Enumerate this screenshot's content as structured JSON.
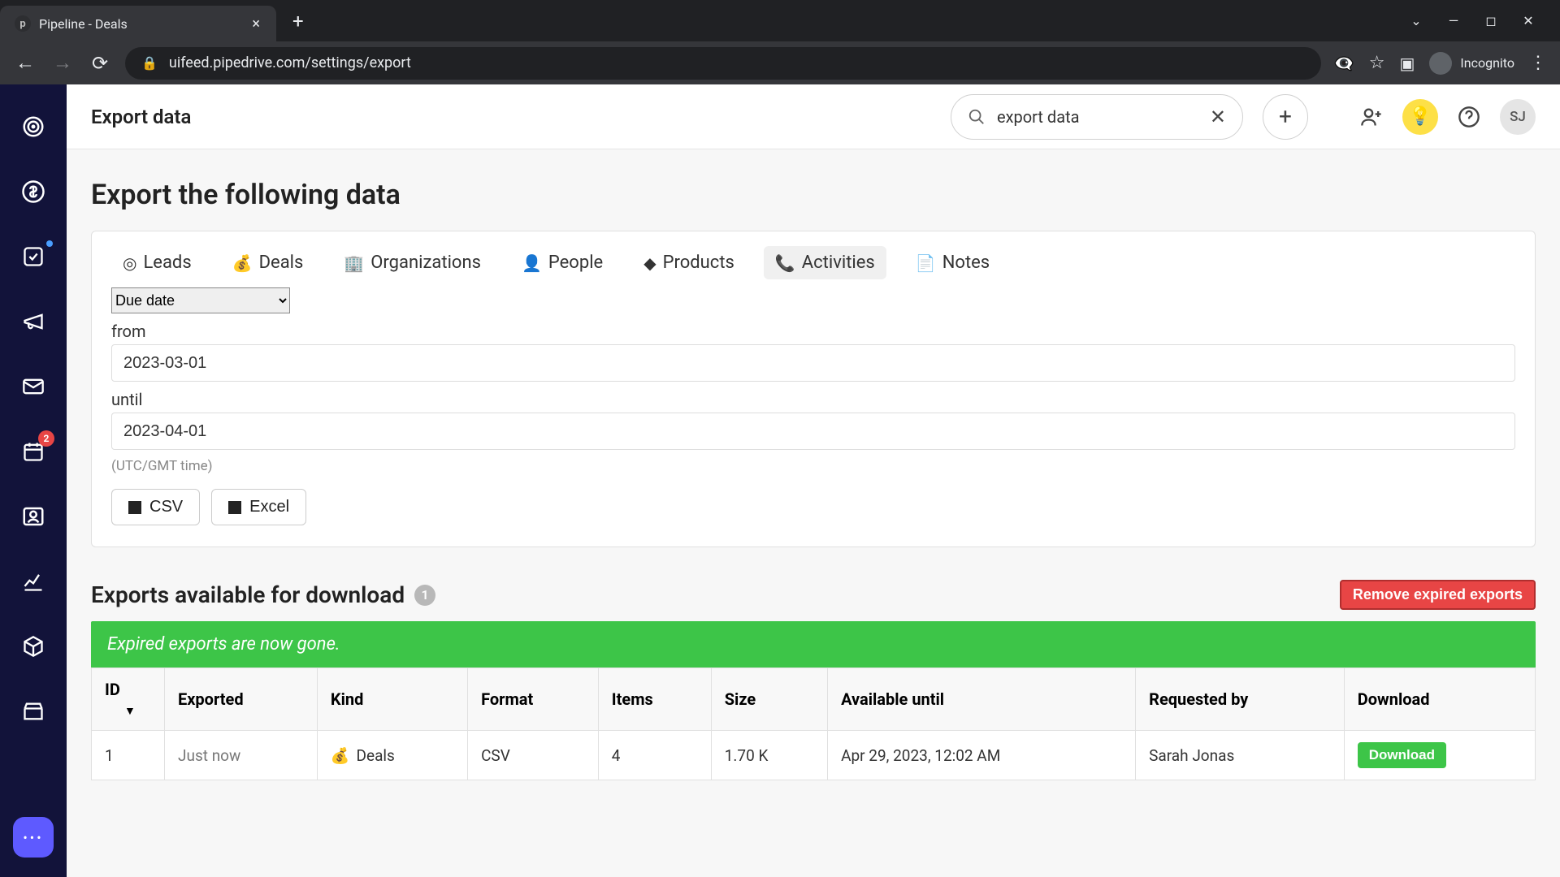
{
  "browser": {
    "tab_title": "Pipeline - Deals",
    "url": "uifeed.pipedrive.com/settings/export",
    "incognito_label": "Incognito"
  },
  "header": {
    "page_title": "Export data",
    "search_value": "export data",
    "avatar_initials": "SJ"
  },
  "sidebar": {
    "notification_count": "2"
  },
  "export": {
    "heading": "Export the following data",
    "tabs": {
      "leads": "Leads",
      "deals": "Deals",
      "organizations": "Organizations",
      "people": "People",
      "products": "Products",
      "activities": "Activities",
      "notes": "Notes"
    },
    "date_type_selected": "Due date",
    "from_label": "from",
    "from_value": "2023-03-01",
    "until_label": "until",
    "until_value": "2023-04-01",
    "timezone_note": "(UTC/GMT time)",
    "csv_label": "CSV",
    "excel_label": "Excel"
  },
  "downloads": {
    "title": "Exports available for download",
    "count": "1",
    "remove_label": "Remove expired exports",
    "banner": "Expired exports are now gone.",
    "columns": {
      "id": "ID",
      "exported": "Exported",
      "kind": "Kind",
      "format": "Format",
      "items": "Items",
      "size": "Size",
      "available_until": "Available until",
      "requested_by": "Requested by",
      "download": "Download"
    },
    "rows": [
      {
        "id": "1",
        "exported": "Just now",
        "kind": "Deals",
        "format": "CSV",
        "items": "4",
        "size": "1.70 K",
        "available_until": "Apr 29, 2023, 12:02 AM",
        "requested_by": "Sarah Jonas",
        "download_label": "Download"
      }
    ]
  }
}
